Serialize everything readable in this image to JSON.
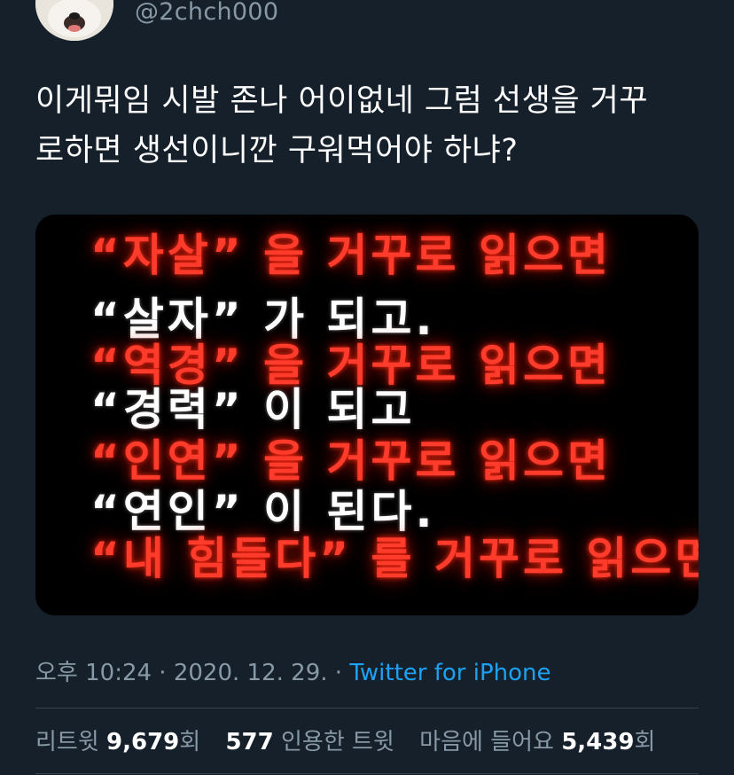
{
  "user": {
    "handle": "@2chch000"
  },
  "tweet": {
    "text_line1": "이게뭐임 시발 존나 어이없네 그럼 선생을 거꾸",
    "text_line2": "로하면 생선이니깐 구워먹어야 하냐?"
  },
  "media": {
    "lines": [
      {
        "text": "“자살” 을 거꾸로 읽으면",
        "color": "red"
      },
      {
        "text": "“살자” 가 되고.",
        "color": "white"
      },
      {
        "text": "“역경” 을 거꾸로 읽으면",
        "color": "red"
      },
      {
        "text": "“경력” 이 되고",
        "color": "white"
      },
      {
        "text": "“인연” 을 거꾸로 읽으면",
        "color": "red"
      },
      {
        "text": "“연인” 이 된다.",
        "color": "white"
      },
      {
        "text": "“내 힘들다” 를 거꾸로 읽으면",
        "color": "red"
      }
    ]
  },
  "meta": {
    "time": "오후 10:24",
    "separator": " · ",
    "date": "2020. 12. 29.",
    "separator2": " · ",
    "source": "Twitter for iPhone"
  },
  "stats": {
    "retweets_label": "리트윗",
    "retweets_count": "9,679",
    "retweets_suffix": "회",
    "quotes_count": "577",
    "quotes_label": "인용한 트윗",
    "likes_label": "마음에 들어요",
    "likes_count": "5,439",
    "likes_suffix": "회"
  },
  "colors": {
    "background": "#15202b",
    "secondary_text": "#8899a6",
    "accent": "#1da1f2",
    "meme_red": "#ff3b2b"
  }
}
